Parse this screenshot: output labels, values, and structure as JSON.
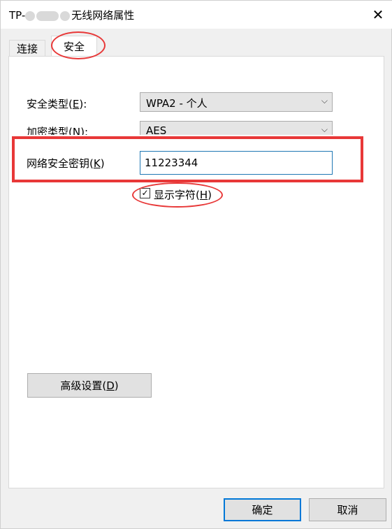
{
  "window": {
    "title_prefix": "TP-",
    "title_suffix": "无线网络属性",
    "close_glyph": "✕"
  },
  "tabs": [
    {
      "label": "连接",
      "active": false
    },
    {
      "label": "安全",
      "active": true
    }
  ],
  "security": {
    "type_label": "安全类型(",
    "type_key": "E",
    "type_label_end": "):",
    "type_value": "WPA2 - 个人",
    "encryption_label": "加密类型(",
    "encryption_key": "N",
    "encryption_label_end": "):",
    "encryption_value": "AES",
    "key_label": "网络安全密钥(",
    "key_key": "K",
    "key_label_end": ")",
    "key_value": "11223344",
    "show_chars_label": "显示字符(",
    "show_chars_key": "H",
    "show_chars_label_end": ")",
    "show_chars_checked": true,
    "checkmark": "✓",
    "dropdown_arrow": "⌵"
  },
  "advanced": {
    "label": "高级设置(",
    "key": "D",
    "label_end": ")"
  },
  "footer": {
    "ok_label": "确定",
    "cancel_label": "取消"
  },
  "colors": {
    "annotation_red": "#e83838",
    "focus_blue": "#0078d7"
  }
}
